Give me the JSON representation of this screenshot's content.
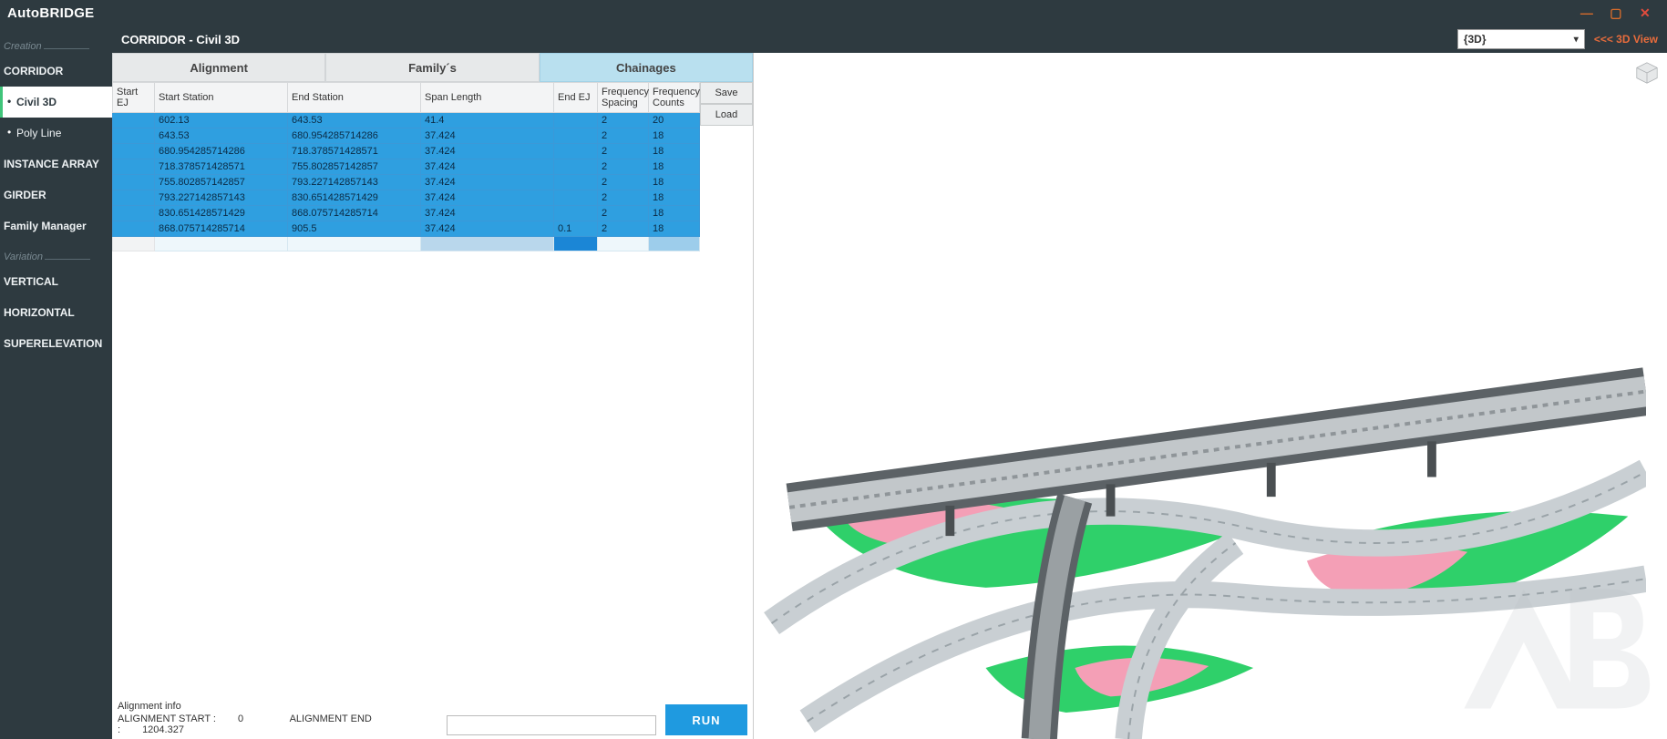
{
  "app": {
    "title": "AutoBRIDGE"
  },
  "window_controls": {
    "min": "—",
    "max": "▢",
    "close": "✕"
  },
  "sidebar": {
    "section_creation": "Creation",
    "section_variation": "Variation",
    "corridor": "CORRIDOR",
    "civil3d": "Civil 3D",
    "polyline": "Poly Line",
    "instance_array": "INSTANCE ARRAY",
    "girder": "GIRDER",
    "family_manager": "Family Manager",
    "vertical": "VERTICAL",
    "horizontal": "HORIZONTAL",
    "superelevation": "SUPERELEVATION"
  },
  "header": {
    "title": "CORRIDOR - Civil 3D",
    "view_select": "{3D}",
    "view_link": "<<< 3D View"
  },
  "tabs": {
    "alignment": "Alignment",
    "familys": "Family´s",
    "chainages": "Chainages"
  },
  "columns": {
    "start_ej": "Start EJ",
    "start_station": "Start Station",
    "end_station": "End Station",
    "span_length": "Span Length",
    "end_ej": "End EJ",
    "freq_spacing": "Frequency Spacing",
    "freq_counts": "Frequency Counts"
  },
  "buttons": {
    "save": "Save",
    "load": "Load",
    "run": "RUN"
  },
  "alignment_info": {
    "label": "Alignment info",
    "start_label": "ALIGNMENT START :",
    "start_val": "0",
    "end_label": "ALIGNMENT END :",
    "end_val": "1204.327"
  },
  "rows": [
    {
      "start_ej": "",
      "start_station": "602.13",
      "end_station": "643.53",
      "span_length": "41.4",
      "end_ej": "",
      "freq_spacing": "2",
      "freq_counts": "20"
    },
    {
      "start_ej": "",
      "start_station": "643.53",
      "end_station": "680.954285714286",
      "span_length": "37.424",
      "end_ej": "",
      "freq_spacing": "2",
      "freq_counts": "18"
    },
    {
      "start_ej": "",
      "start_station": "680.954285714286",
      "end_station": "718.378571428571",
      "span_length": "37.424",
      "end_ej": "",
      "freq_spacing": "2",
      "freq_counts": "18"
    },
    {
      "start_ej": "",
      "start_station": "718.378571428571",
      "end_station": "755.802857142857",
      "span_length": "37.424",
      "end_ej": "",
      "freq_spacing": "2",
      "freq_counts": "18"
    },
    {
      "start_ej": "",
      "start_station": "755.802857142857",
      "end_station": "793.227142857143",
      "span_length": "37.424",
      "end_ej": "",
      "freq_spacing": "2",
      "freq_counts": "18"
    },
    {
      "start_ej": "",
      "start_station": "793.227142857143",
      "end_station": "830.651428571429",
      "span_length": "37.424",
      "end_ej": "",
      "freq_spacing": "2",
      "freq_counts": "18"
    },
    {
      "start_ej": "",
      "start_station": "830.651428571429",
      "end_station": "868.075714285714",
      "span_length": "37.424",
      "end_ej": "",
      "freq_spacing": "2",
      "freq_counts": "18"
    },
    {
      "start_ej": "",
      "start_station": "868.075714285714",
      "end_station": "905.5",
      "span_length": "37.424",
      "end_ej": "0.1",
      "freq_spacing": "2",
      "freq_counts": "18"
    }
  ]
}
